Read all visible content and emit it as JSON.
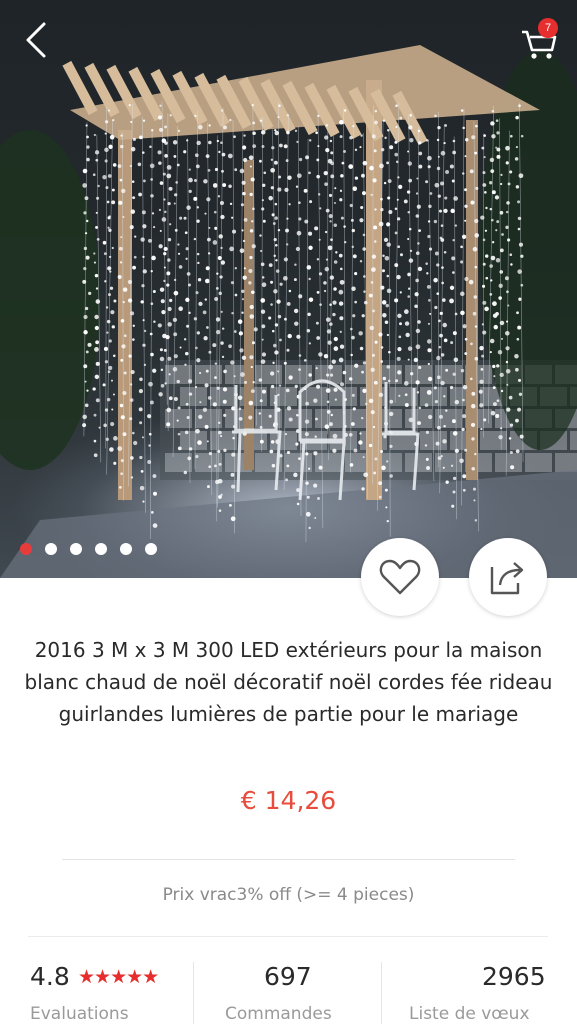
{
  "header": {
    "back_icon": "chevron-left-icon",
    "cart_icon": "cart-icon",
    "cart_count": "7"
  },
  "gallery": {
    "image_description_icon": "product-photo",
    "slide_count": 6,
    "active_slide": 1
  },
  "actions": {
    "favorite_icon": "heart-icon",
    "share_icon": "share-icon"
  },
  "product": {
    "title": "2016 3 M x 3 M 300 LED extérieurs pour la maison blanc chaud de noël décoratif noël cordes fée rideau guirlandes lumières de partie pour le mariage",
    "price": "€ 14,26",
    "bulk_price": "Prix vrac3% off (>= 4 pieces)"
  },
  "stats": {
    "rating": "4.8",
    "stars": "★★★★★",
    "rating_label": "Evaluations",
    "orders": "697",
    "orders_label": "Commandes",
    "wishlist": "2965",
    "wishlist_label": "Liste de vœux"
  },
  "colors": {
    "accent": "#e74c3c",
    "badge": "#e62e2e"
  }
}
